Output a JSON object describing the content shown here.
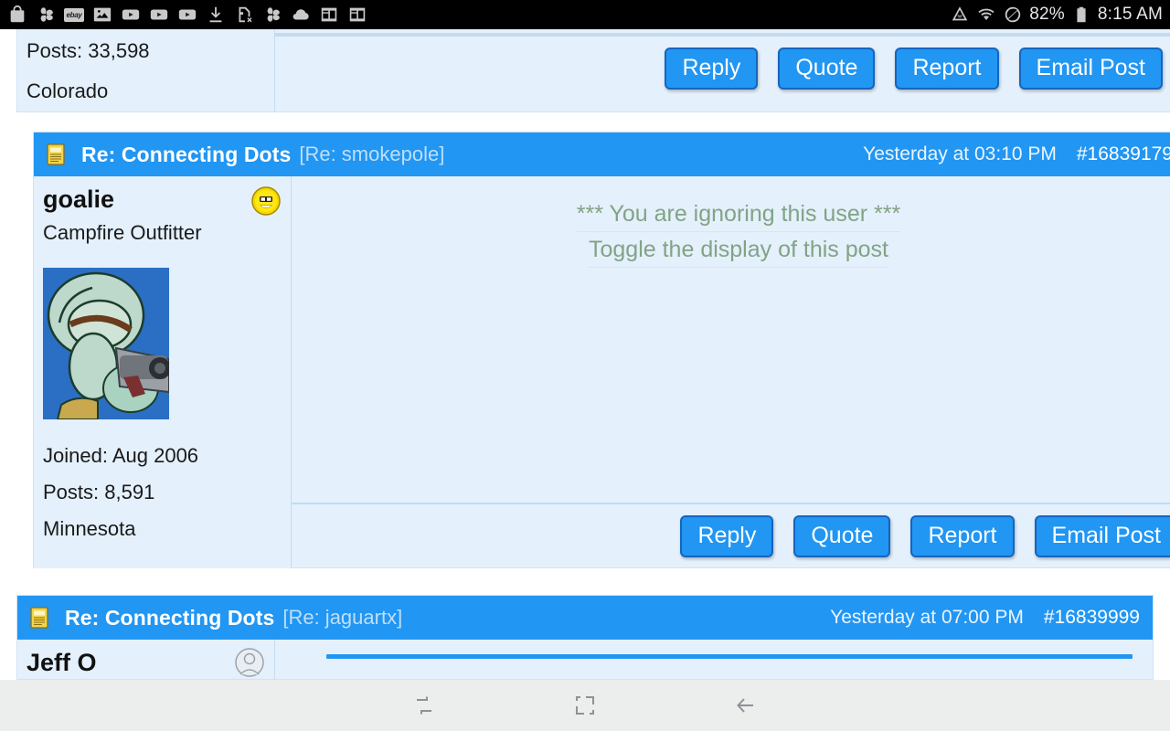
{
  "status_bar": {
    "left_icons": [
      "shopping-bag-icon",
      "pinwheel-icon",
      "ebay-icon",
      "photo-icon",
      "youtube-icon",
      "youtube-icon",
      "youtube-icon",
      "download-icon",
      "sim-card-removed-icon",
      "pinwheel-icon",
      "cloud-icon",
      "news-icon",
      "news-icon"
    ],
    "ebay_label": "ebay",
    "right_icons": [
      "data-saver-icon",
      "wifi-icon",
      "do-not-disturb-icon",
      "battery-icon"
    ],
    "battery_percent": "82%",
    "clock": "8:15 AM"
  },
  "posts": [
    {
      "user": {
        "posts": "Posts: 33,598",
        "location": "Colorado"
      },
      "actions": [
        "Reply",
        "Quote",
        "Report",
        "Email Post"
      ]
    },
    {
      "header": {
        "icon": "note-icon",
        "title": "Re: Connecting Dots",
        "reply_to": "[Re: smokepole]",
        "date": "Yesterday at 03:10 PM",
        "post_number": "#16839179"
      },
      "user": {
        "name": "goalie",
        "rank": "Campfire Outfitter",
        "status_icon": "smiley-icon",
        "avatar": "squidward-avatar",
        "joined": "Joined: Aug 2006",
        "posts": "Posts: 8,591",
        "location": "Minnesota"
      },
      "ignore_notice": {
        "line1": "*** You are ignoring this user ***",
        "line2": "Toggle the display of this post"
      },
      "actions": [
        "Reply",
        "Quote",
        "Report",
        "Email Post"
      ]
    },
    {
      "header": {
        "icon": "note-icon",
        "title": "Re: Connecting Dots",
        "reply_to": "[Re: jaguartx]",
        "date": "Yesterday at 07:00 PM",
        "post_number": "#16839999"
      },
      "user": {
        "name": "Jeff O",
        "status_icon": "grey-avatar-icon"
      }
    }
  ],
  "nav_bar": {
    "items": [
      {
        "name": "recent-apps",
        "label": "Recent apps"
      },
      {
        "name": "home",
        "label": "Home"
      },
      {
        "name": "back",
        "label": "Back"
      }
    ]
  },
  "colors": {
    "accent_blue": "#2196f3",
    "post_bg": "#e4f0fb",
    "ignore_text": "#82a386",
    "status_bar_bg": "#000000",
    "nav_bar_bg": "#eceded"
  }
}
